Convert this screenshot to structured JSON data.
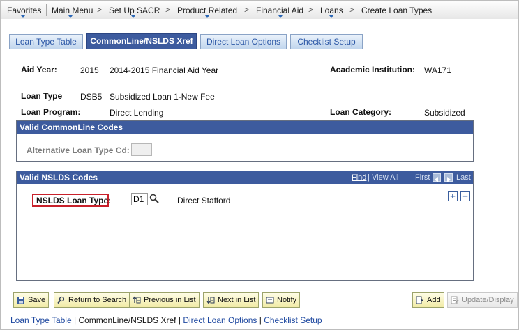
{
  "menu": {
    "items": [
      "Favorites",
      "Main Menu",
      "Set Up SACR",
      "Product Related",
      "Financial Aid",
      "Loans",
      "Create Loan Types"
    ],
    "separator_glyph": "|",
    "chevron_glyph": ">"
  },
  "tabs": [
    {
      "label": "Loan Type Table",
      "active": false
    },
    {
      "label": "CommonLine/NSLDS Xref",
      "active": true
    },
    {
      "label": "Direct Loan Options",
      "active": false
    },
    {
      "label": "Checklist Setup",
      "active": false
    }
  ],
  "info": {
    "aid_year_label": "Aid Year:",
    "aid_year_value": "2015",
    "aid_year_desc": "2014-2015 Financial Aid Year",
    "institution_label": "Academic Institution:",
    "institution_value": "WA171",
    "loan_type_label": "Loan Type",
    "loan_type_code": "DSB5",
    "loan_type_desc": "Subsidized Loan 1-New Fee",
    "loan_program_label": "Loan Program:",
    "loan_program_value": "Direct Lending",
    "loan_category_label": "Loan Category:",
    "loan_category_value": "Subsidized"
  },
  "commonline": {
    "header": "Valid CommonLine Codes",
    "alt_loan_label": "Alternative Loan Type Cd:",
    "alt_loan_value": ""
  },
  "nslds": {
    "header": "Valid NSLDS Codes",
    "nav_find": "Find",
    "nav_sep": "|",
    "nav_view_all": "View All",
    "nav_first": "First",
    "nav_last": "Last",
    "loan_type_label": "NSLDS Loan Type:",
    "loan_type_value": "D1",
    "loan_type_desc": "Direct Stafford",
    "add_row_glyph": "+",
    "delete_row_glyph": "−"
  },
  "toolbar": {
    "save": "Save",
    "return_to_search": "Return to Search",
    "previous_in_list": "Previous in List",
    "next_in_list": "Next in List",
    "notify": "Notify",
    "add": "Add",
    "update_display": "Update/Display"
  },
  "bottom_links": {
    "items": [
      "Loan Type Table",
      "CommonLine/NSLDS Xref",
      "Direct Loan Options",
      "Checklist Setup"
    ],
    "separator": "|"
  },
  "colors": {
    "header_blue": "#3d5b9e",
    "tab_text_blue": "#2b57a6",
    "highlight_red": "#c8202a",
    "button_yellow": "#f1eba6"
  },
  "icons": {
    "lookup": "magnifier-icon",
    "prev_row": "left-arrow-icon",
    "next_row": "right-arrow-icon",
    "save": "save-icon",
    "return": "search-icon",
    "prev_list": "previous-list-icon",
    "next_list": "next-list-icon",
    "notify": "notify-icon",
    "add": "add-icon",
    "update": "update-icon"
  }
}
